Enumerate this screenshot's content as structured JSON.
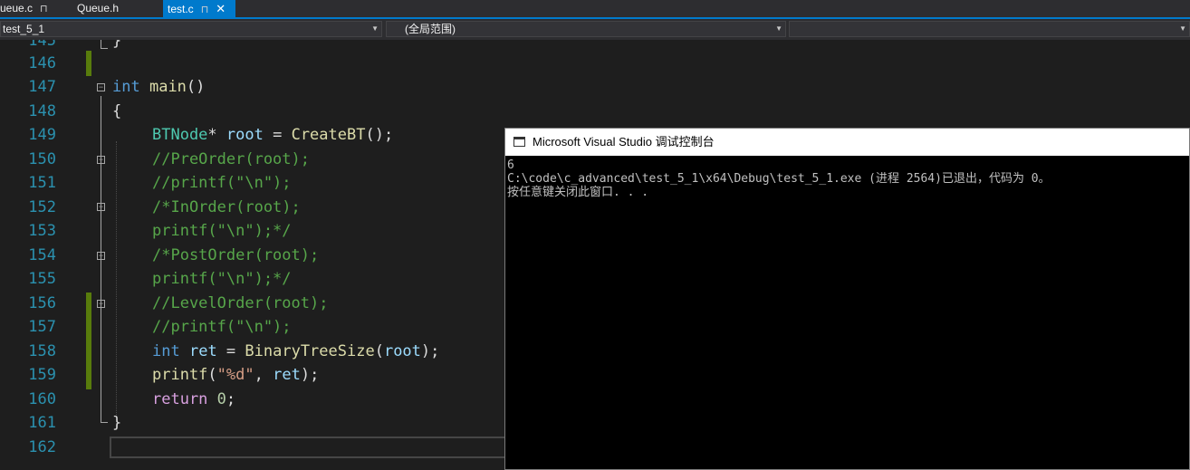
{
  "tabs": [
    {
      "label": "ueue.c",
      "pin": "⊓"
    },
    {
      "label": "Queue.h"
    },
    {
      "label": "test.c",
      "pin": "⊓",
      "close": "✕",
      "active": true
    }
  ],
  "navbar": {
    "project": "test_5_1",
    "scope": "(全局范围)",
    "member": ""
  },
  "editor": {
    "line_numbers": [
      "145",
      "146",
      "147",
      "148",
      "149",
      "150",
      "151",
      "152",
      "153",
      "154",
      "155",
      "156",
      "157",
      "158",
      "159",
      "160",
      "161",
      "162"
    ]
  },
  "console": {
    "title": "Microsoft Visual Studio 调试控制台",
    "lines": [
      "6",
      "C:\\code\\c_advanced\\test_5_1\\x64\\Debug\\test_5_1.exe (进程 2564)已退出，代码为 0。",
      "按任意键关闭此窗口. . ."
    ]
  },
  "colors": {
    "tab_active": "#007acc",
    "editor_bg": "#1e1e1e",
    "line_number": "#2b91af",
    "keyword": "#569cd6",
    "comment": "#57a64a",
    "change_marker": "#587c0c"
  }
}
